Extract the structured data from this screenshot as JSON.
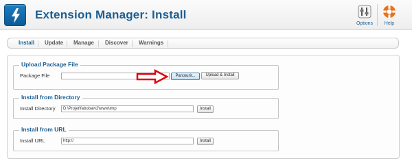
{
  "header": {
    "title": "Extension Manager: Install",
    "options_label": "Options",
    "help_label": "Help"
  },
  "nav": {
    "items": [
      "Install",
      "Update",
      "Manage",
      "Discover",
      "Warnings"
    ],
    "active": "Install"
  },
  "upload": {
    "legend": "Upload Package File",
    "label": "Package File",
    "file_value": "",
    "browse_label": "Parcourir...",
    "submit_label": "Upload & Install"
  },
  "directory": {
    "legend": "Install from Directory",
    "label": "Install Directory",
    "value": "D:\\Projet\\faboba\\v2\\www\\tmp",
    "submit_label": "Install"
  },
  "url": {
    "legend": "Install from URL",
    "label": "Install URL",
    "value": "http://",
    "submit_label": "Install"
  },
  "colors": {
    "accent": "#1b5e92",
    "arrow": "#e0000a"
  },
  "icons": [
    "joomla-logo-icon",
    "options-icon",
    "help-lifebuoy-icon",
    "red-arrow-annotation"
  ]
}
